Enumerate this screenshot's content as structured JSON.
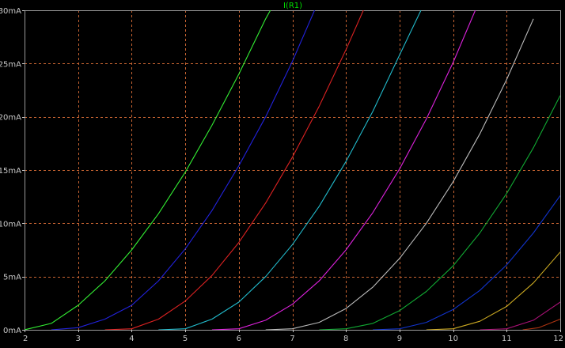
{
  "chart_data": {
    "type": "line",
    "title": "I(R1)",
    "title_color": "#00e000",
    "xlim": [
      2,
      12
    ],
    "ylim": [
      0,
      30
    ],
    "x_ticks": [
      "2",
      "3",
      "4",
      "5",
      "6",
      "7",
      "8",
      "9",
      "10",
      "11",
      "12"
    ],
    "y_ticks": [
      "0mA",
      "5mA",
      "10mA",
      "15mA",
      "20mA",
      "25mA",
      "30mA"
    ],
    "grid": true,
    "background": "#000000",
    "grid_color": "#c86432",
    "tick_label_color": "#c8c8c8",
    "series": [
      {
        "color": "#33ee33",
        "x": [
          2.0,
          2.5,
          3.0,
          3.5,
          4.0,
          4.5,
          5.0,
          5.5,
          6.0,
          6.5,
          6.7
        ],
        "y": [
          0.0,
          0.6,
          2.3,
          4.6,
          7.5,
          10.9,
          14.8,
          19.2,
          24.0,
          29.2,
          31.0
        ]
      },
      {
        "color": "#2222dd",
        "x": [
          2.5,
          3.0,
          3.5,
          4.0,
          4.5,
          5.0,
          5.5,
          6.0,
          6.5,
          7.0,
          7.5
        ],
        "y": [
          0.0,
          0.2,
          1.0,
          2.3,
          4.6,
          7.6,
          11.2,
          15.4,
          20.0,
          25.2,
          31.0
        ]
      },
      {
        "color": "#dd2222",
        "x": [
          3.5,
          4.0,
          4.5,
          5.0,
          5.5,
          6.0,
          6.5,
          7.0,
          7.5,
          8.0,
          8.5
        ],
        "y": [
          0.0,
          0.1,
          1.0,
          2.7,
          5.1,
          8.2,
          11.9,
          16.2,
          21.0,
          26.3,
          32.0
        ]
      },
      {
        "color": "#22bbcc",
        "x": [
          4.5,
          5.0,
          5.5,
          6.0,
          6.5,
          7.0,
          7.5,
          8.0,
          8.5,
          9.0,
          9.4
        ],
        "y": [
          0.0,
          0.1,
          1.0,
          2.6,
          5.0,
          8.0,
          11.6,
          15.8,
          20.5,
          25.8,
          30.0
        ]
      },
      {
        "color": "#dd22dd",
        "x": [
          5.5,
          6.0,
          6.5,
          7.0,
          7.5,
          8.0,
          8.5,
          9.0,
          9.5,
          10.0,
          10.5
        ],
        "y": [
          0.0,
          0.1,
          0.9,
          2.4,
          4.6,
          7.5,
          11.0,
          15.1,
          19.8,
          25.1,
          31.0
        ]
      },
      {
        "color": "#bbbbbb",
        "x": [
          6.5,
          7.0,
          7.5,
          8.0,
          8.5,
          9.0,
          9.5,
          10.0,
          10.5,
          11.0,
          11.5
        ],
        "y": [
          0.0,
          0.1,
          0.7,
          2.0,
          4.0,
          6.7,
          10.0,
          13.9,
          18.4,
          23.5,
          29.2
        ]
      },
      {
        "color": "#11aa33",
        "x": [
          7.5,
          8.0,
          8.5,
          9.0,
          9.5,
          10.0,
          10.5,
          11.0,
          11.5,
          12.0
        ],
        "y": [
          0.0,
          0.1,
          0.6,
          1.8,
          3.6,
          6.0,
          9.1,
          12.8,
          17.1,
          22.0
        ]
      },
      {
        "color": "#1133cc",
        "x": [
          8.5,
          9.0,
          9.5,
          10.0,
          10.5,
          11.0,
          11.5,
          12.0
        ],
        "y": [
          0.0,
          0.1,
          0.7,
          1.9,
          3.7,
          6.1,
          9.1,
          12.6
        ]
      },
      {
        "color": "#ccaa22",
        "x": [
          9.5,
          10.0,
          10.5,
          11.0,
          11.5,
          12.0
        ],
        "y": [
          0.0,
          0.1,
          0.8,
          2.2,
          4.4,
          7.3
        ]
      },
      {
        "color": "#aa1177",
        "x": [
          10.5,
          11.0,
          11.5,
          12.0
        ],
        "y": [
          0.0,
          0.1,
          0.9,
          2.6
        ]
      },
      {
        "color": "#aa3311",
        "x": [
          11.3,
          11.6,
          12.0
        ],
        "y": [
          0.0,
          0.2,
          1.0
        ]
      }
    ]
  }
}
